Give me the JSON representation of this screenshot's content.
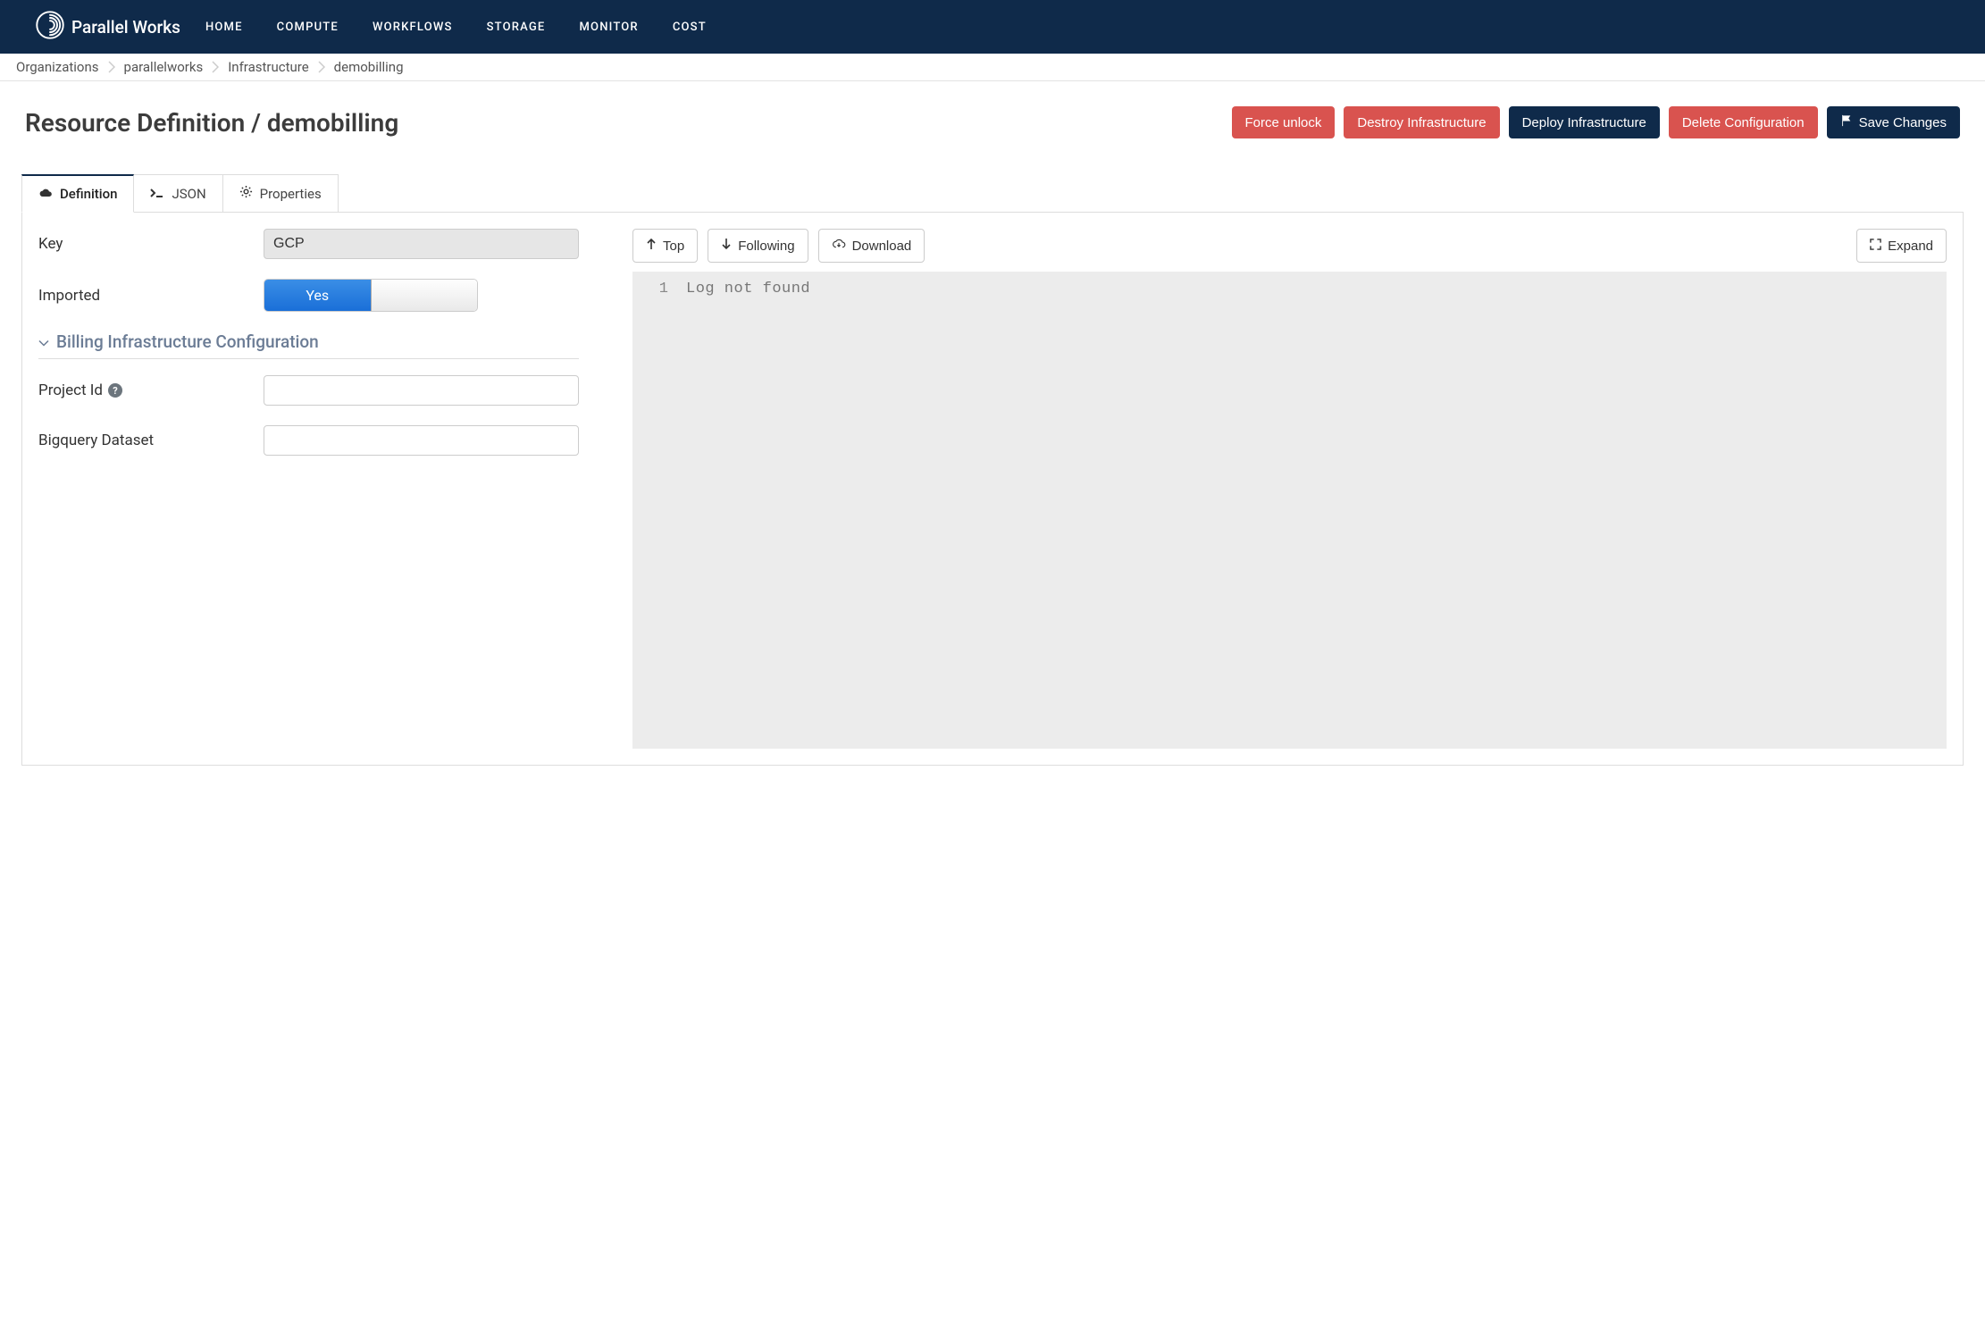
{
  "brand": "Parallel Works",
  "nav": {
    "home": "HOME",
    "compute": "COMPUTE",
    "workflows": "WORKFLOWS",
    "storage": "STORAGE",
    "monitor": "MONITOR",
    "cost": "COST"
  },
  "breadcrumbs": {
    "organizations": "Organizations",
    "org_name": "parallelworks",
    "infrastructure": "Infrastructure",
    "resource": "demobilling"
  },
  "page_title": "Resource Definition / demobilling",
  "actions": {
    "force_unlock": "Force unlock",
    "destroy": "Destroy Infrastructure",
    "deploy": "Deploy Infrastructure",
    "delete": "Delete Configuration",
    "save": "Save Changes"
  },
  "tabs": {
    "definition": "Definition",
    "json": "JSON",
    "properties": "Properties"
  },
  "form": {
    "key_label": "Key",
    "key_value": "GCP",
    "imported_label": "Imported",
    "imported_yes": "Yes",
    "section_title": "Billing Infrastructure Configuration",
    "project_id_label": "Project Id",
    "project_id_value": "",
    "bigquery_label": "Bigquery Dataset",
    "bigquery_value": ""
  },
  "log_toolbar": {
    "top": "Top",
    "following": "Following",
    "download": "Download",
    "expand": "Expand"
  },
  "log": {
    "line1_num": "1",
    "line1_text": "Log not found"
  }
}
